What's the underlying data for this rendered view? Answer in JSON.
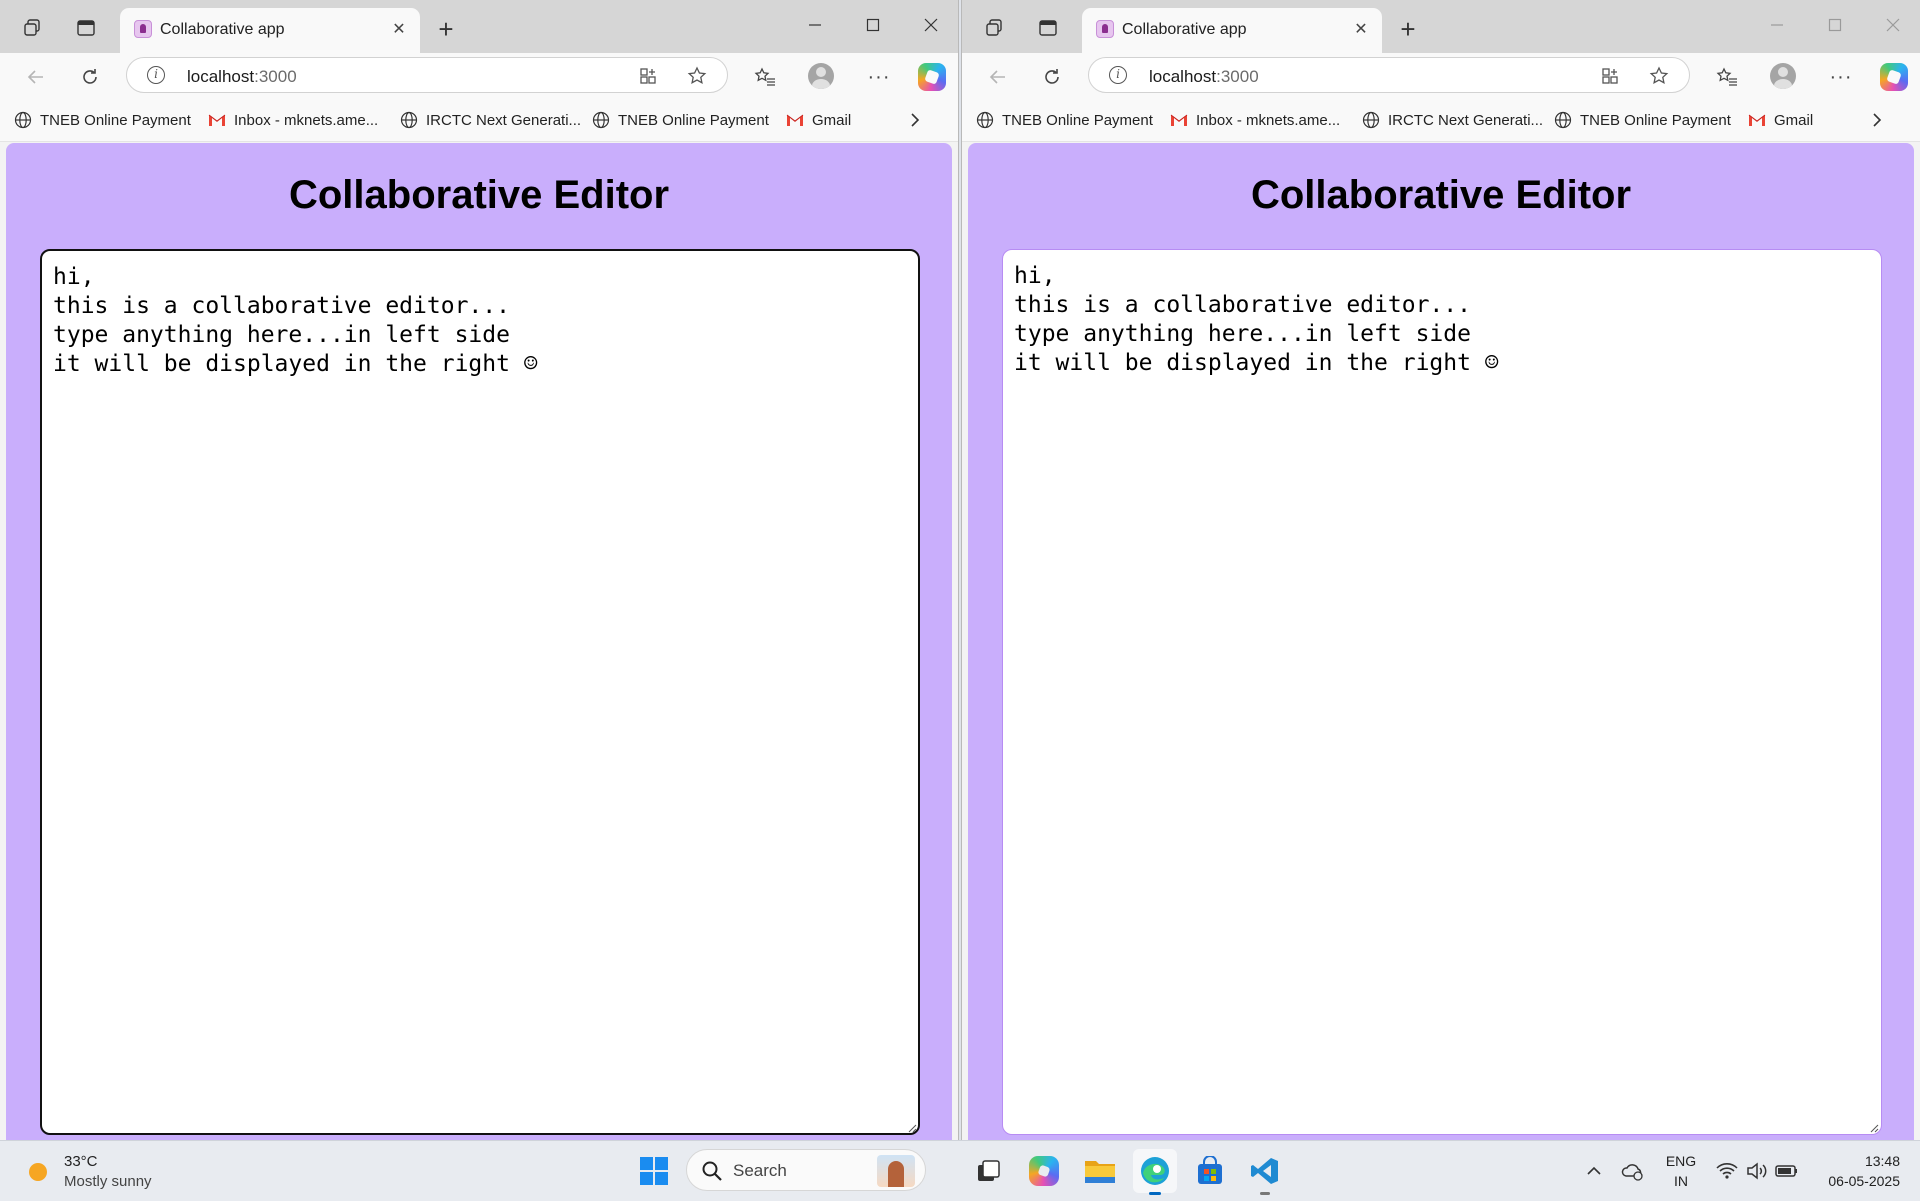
{
  "browser": {
    "tab_title": "Collaborative app",
    "url_host": "localhost",
    "url_port": ":3000",
    "favorites": [
      {
        "label": "TNEB Online Payment",
        "icon": "globe-icon"
      },
      {
        "label": "Inbox - mknets.ame...",
        "icon": "gmail-icon"
      },
      {
        "label": "IRCTC Next Generati...",
        "icon": "globe-icon"
      },
      {
        "label": "TNEB Online Payment",
        "icon": "globe-icon"
      },
      {
        "label": "Gmail",
        "icon": "gmail-icon"
      }
    ]
  },
  "page": {
    "title": "Collaborative Editor",
    "background_color": "#c9aefc"
  },
  "editor_left": {
    "content": "hi,\nthis is a collaborative editor...\ntype anything here...in left side\nit will be displayed in the right ☺"
  },
  "editor_right": {
    "content": "hi,\nthis is a collaborative editor...\ntype anything here...in left side\nit will be displayed in the right ☺"
  },
  "taskbar": {
    "weather_temp": "33°C",
    "weather_condition": "Mostly sunny",
    "search_label": "Search",
    "lang_line1": "ENG",
    "lang_line2": "IN",
    "time": "13:48",
    "date": "06-05-2025",
    "apps": [
      "task-view-icon",
      "copilot-icon",
      "file-explorer-icon",
      "edge-icon",
      "microsoft-store-icon",
      "vscode-icon"
    ]
  }
}
